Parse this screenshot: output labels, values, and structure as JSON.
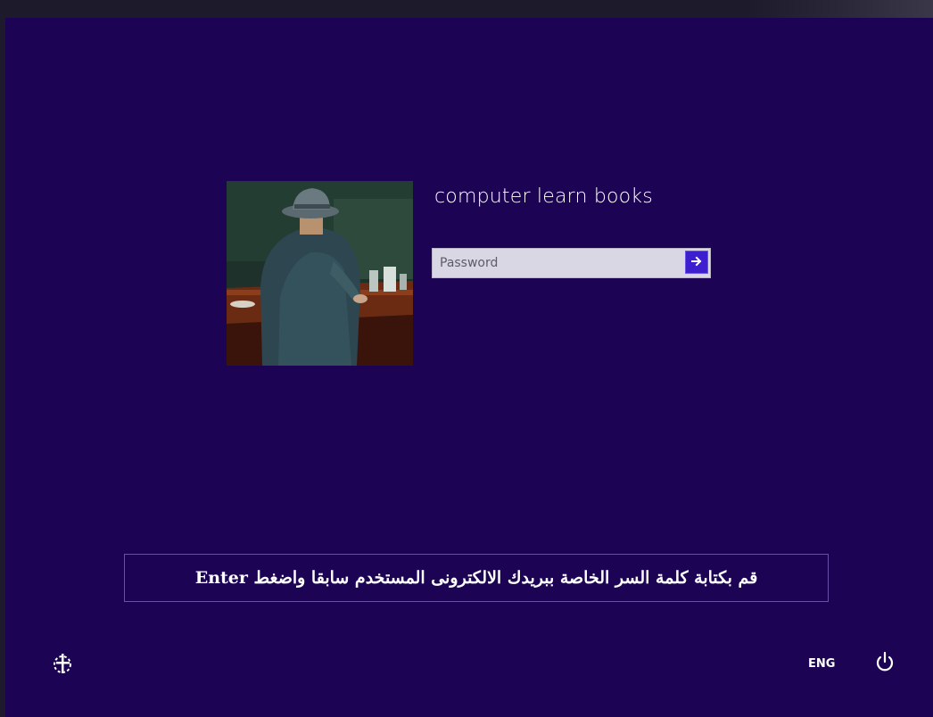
{
  "lock_screen": {
    "user_name": "computer learn books",
    "password_placeholder": "Password",
    "submit_icon": "arrow-right-icon",
    "caption": "قم بكتابة كلمة السر الخاصة ببريدك الالكترونى المستخدم سابقا واضغط Enter",
    "ease_of_access_icon": "ease-of-access-icon",
    "language": "ENG",
    "power_icon": "power-icon"
  },
  "colors": {
    "background": "#1c0353",
    "accent_button": "#3d1fd0",
    "input_background": "#d9d7e3",
    "text": "#ffffff",
    "caption_border": "#6b4ea8"
  }
}
